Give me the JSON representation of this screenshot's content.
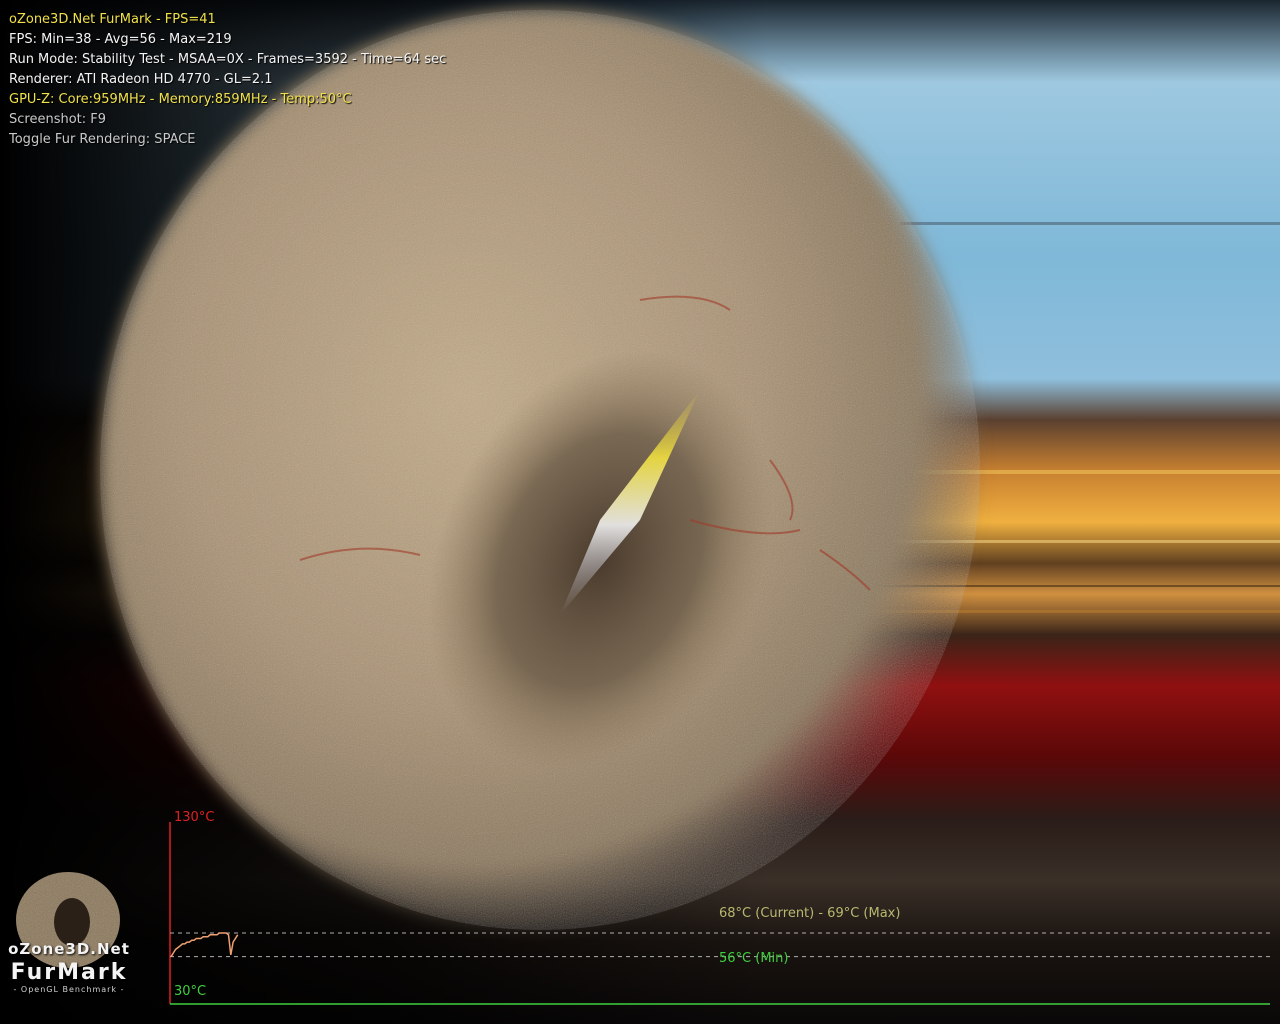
{
  "window": {
    "title": "oZone3D.Net FurMark - FPS=41"
  },
  "overlay": {
    "lines": [
      "oZone3D.Net FurMark - FPS=41",
      "FPS: Min=38 - Avg=56 - Max=219",
      "Run Mode: Stability Test - MSAA=0X - Frames=3592 - Time=64 sec",
      "Renderer: ATI Radeon HD 4770  - GL=2.1",
      "GPU-Z: Core:959MHz - Memory:859MHz - Temp:50°C",
      "Screenshot: F9",
      "Toggle Fur Rendering: SPACE"
    ]
  },
  "logo": {
    "site": "oZone3D.Net",
    "product": "FurMark",
    "tagline": "- OpenGL Benchmark -"
  },
  "temp_graph": {
    "max_label": "130°C",
    "min_axis_label": "30°C",
    "current_max_label": "68°C (Current) - 69°C (Max)",
    "min_label": "56°C (Min)",
    "axis_max": 130,
    "axis_min": 30,
    "current": 68,
    "max": 69,
    "min": 56,
    "series": [
      56,
      58,
      60,
      61,
      62,
      63,
      63,
      64,
      64,
      65,
      65,
      66,
      66,
      66,
      67,
      67,
      67,
      68,
      68,
      68,
      68,
      69,
      69,
      69,
      69,
      68,
      57,
      64,
      66,
      68
    ],
    "colors": {
      "max_axis": "#e02020",
      "min_axis": "#40d040",
      "current": "#b8b870",
      "min": "#40d040",
      "line": "#f0a070"
    }
  },
  "colors": {
    "fur": "#a88f6a",
    "overlay_yellow": "#f0e04a"
  }
}
